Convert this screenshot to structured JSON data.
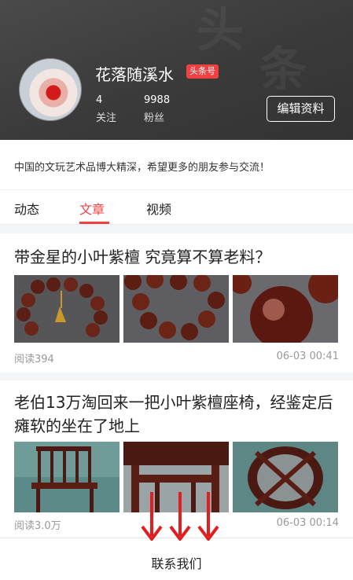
{
  "profile": {
    "name": "花落随溪水",
    "badge": "头条号",
    "following_count": "4",
    "following_label": "关注",
    "followers_count": "9988",
    "followers_label": "粉丝",
    "edit_button": "编辑资料",
    "intro": "中国的文玩艺术品博大精深，希望更多的朋友参与交流！"
  },
  "tabs": [
    {
      "label": "动态",
      "active": false
    },
    {
      "label": "文章",
      "active": true
    },
    {
      "label": "视频",
      "active": false
    }
  ],
  "articles": [
    {
      "title": "带金星的小叶紫檀 究竟算不算老料？",
      "reads": "阅读394",
      "time": "06-03 00:41"
    },
    {
      "title": "老伯13万淘回来一把小叶紫檀座椅，经鉴定后 瘫软的坐在了地上",
      "reads": "阅读3.0万",
      "time": "06-03 00:14"
    }
  ],
  "footer": {
    "contact_label": "联系我们"
  },
  "colors": {
    "accent": "#f04142",
    "header_bg": "#3e3e3e"
  }
}
